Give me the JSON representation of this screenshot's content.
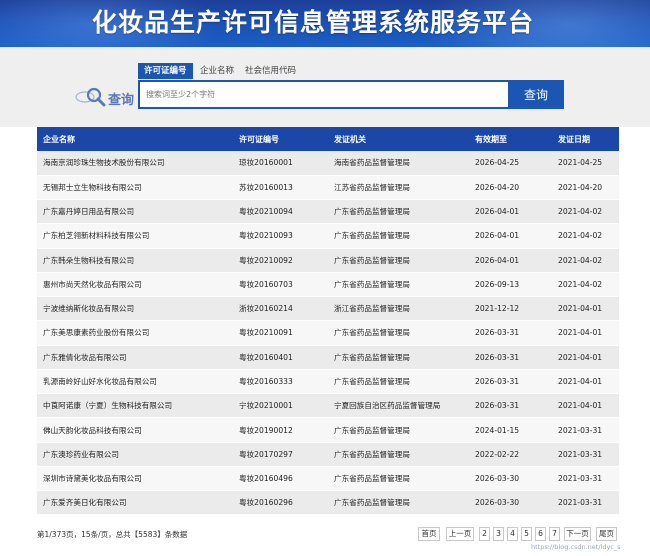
{
  "header": {
    "title": "化妆品生产许可信息管理系统服务平台"
  },
  "search": {
    "logo_label": "查询",
    "tabs": [
      {
        "label": "许可证编号",
        "active": true
      },
      {
        "label": "企业名称",
        "active": false
      },
      {
        "label": "社会信用代码",
        "active": false
      }
    ],
    "placeholder": "搜索词至少2个字符",
    "button_label": "查询"
  },
  "table": {
    "columns": [
      "企业名称",
      "许可证编号",
      "发证机关",
      "有效期至",
      "发证日期"
    ],
    "rows": [
      [
        "海南京润珍珠生物技术股份有限公司",
        "琼妆20160001",
        "海南省药品监督管理局",
        "2026-04-25",
        "2021-04-25"
      ],
      [
        "无锡邦士立生物科技有限公司",
        "苏妆20160013",
        "江苏省药品监督管理局",
        "2026-04-20",
        "2021-04-20"
      ],
      [
        "广东嘉丹婷日用品有限公司",
        "粤妆20210094",
        "广东省药品监督管理局",
        "2026-04-01",
        "2021-04-02"
      ],
      [
        "广东柏芝翎新材料科技有限公司",
        "粤妆20210093",
        "广东省药品监督管理局",
        "2026-04-01",
        "2021-04-02"
      ],
      [
        "广东韩朵生物科技有限公司",
        "粤妆20210092",
        "广东省药品监督管理局",
        "2026-04-01",
        "2021-04-02"
      ],
      [
        "惠州市尚天然化妆品有限公司",
        "粤妆20160703",
        "广东省药品监督管理局",
        "2026-09-13",
        "2021-04-02"
      ],
      [
        "宁波维纳斯化妆品有限公司",
        "浙妆20160214",
        "浙江省药品监督管理局",
        "2021-12-12",
        "2021-04-01"
      ],
      [
        "广东美思康素药业股份有限公司",
        "粤妆20210091",
        "广东省药品监督管理局",
        "2026-03-31",
        "2021-04-01"
      ],
      [
        "广东雅倩化妆品有限公司",
        "粤妆20160401",
        "广东省药品监督管理局",
        "2026-03-31",
        "2021-04-01"
      ],
      [
        "乳源南岭好山好水化妆品有限公司",
        "粤妆20160333",
        "广东省药品监督管理局",
        "2026-03-31",
        "2021-04-01"
      ],
      [
        "中莨阿诺康（宁夏）生物科技有限公司",
        "宁妆20210001",
        "宁夏回族自治区药品监督管理局",
        "2026-03-31",
        "2021-04-01"
      ],
      [
        "佛山天韵化妆品科技有限公司",
        "粤妆20190012",
        "广东省药品监督管理局",
        "2024-01-15",
        "2021-03-31"
      ],
      [
        "广东澳珍药业有限公司",
        "粤妆20170297",
        "广东省药品监督管理局",
        "2022-02-22",
        "2021-03-31"
      ],
      [
        "深圳市诗黛美化妆品有限公司",
        "粤妆20160496",
        "广东省药品监督管理局",
        "2026-03-30",
        "2021-03-31"
      ],
      [
        "广东爱齐美日化有限公司",
        "粤妆20160296",
        "广东省药品监督管理局",
        "2026-03-30",
        "2021-03-31"
      ]
    ]
  },
  "pagination": {
    "info": "第1/373页，15条/页，总共【5583】条数据",
    "first": "首页",
    "prev": "上一页",
    "pages": [
      "2",
      "3",
      "4",
      "5",
      "6",
      "7"
    ],
    "next": "下一页",
    "last": "尾页"
  },
  "watermark": "https://blog.csdn.net/ldyc_s"
}
